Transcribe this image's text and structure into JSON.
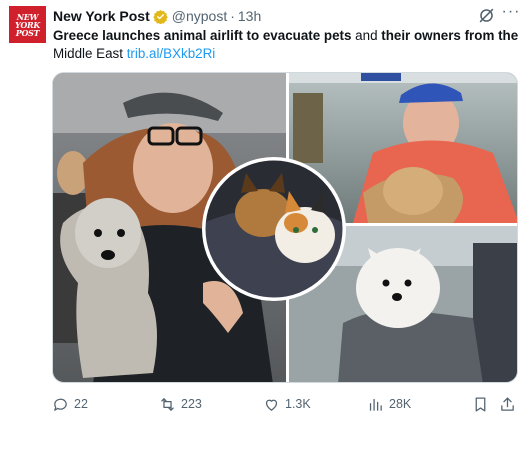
{
  "account": {
    "avatar_lines": [
      "NEW",
      "YORK",
      "POST"
    ],
    "name": "New York Post",
    "handle": "@nypost",
    "separator": "·",
    "time": "13h",
    "verified_color": "#e2b719"
  },
  "post": {
    "bold_1": "Greece launches animal airlift to evacuate pets",
    "plain_1": " and ",
    "bold_2": "their owners from the",
    "plain_2": "Middle East ",
    "link": "trib.al/BXkb2Ri"
  },
  "media": {
    "description": "Photo collage of pets evacuated by airlift",
    "icons": [
      "grok-icon",
      "more-icon"
    ]
  },
  "actions": {
    "replies": "22",
    "reposts": "223",
    "likes": "1.3K",
    "views": "28K"
  },
  "colors": {
    "link": "#1d9bf0",
    "secondary_text": "#536471",
    "brand_red": "#d0202b"
  }
}
